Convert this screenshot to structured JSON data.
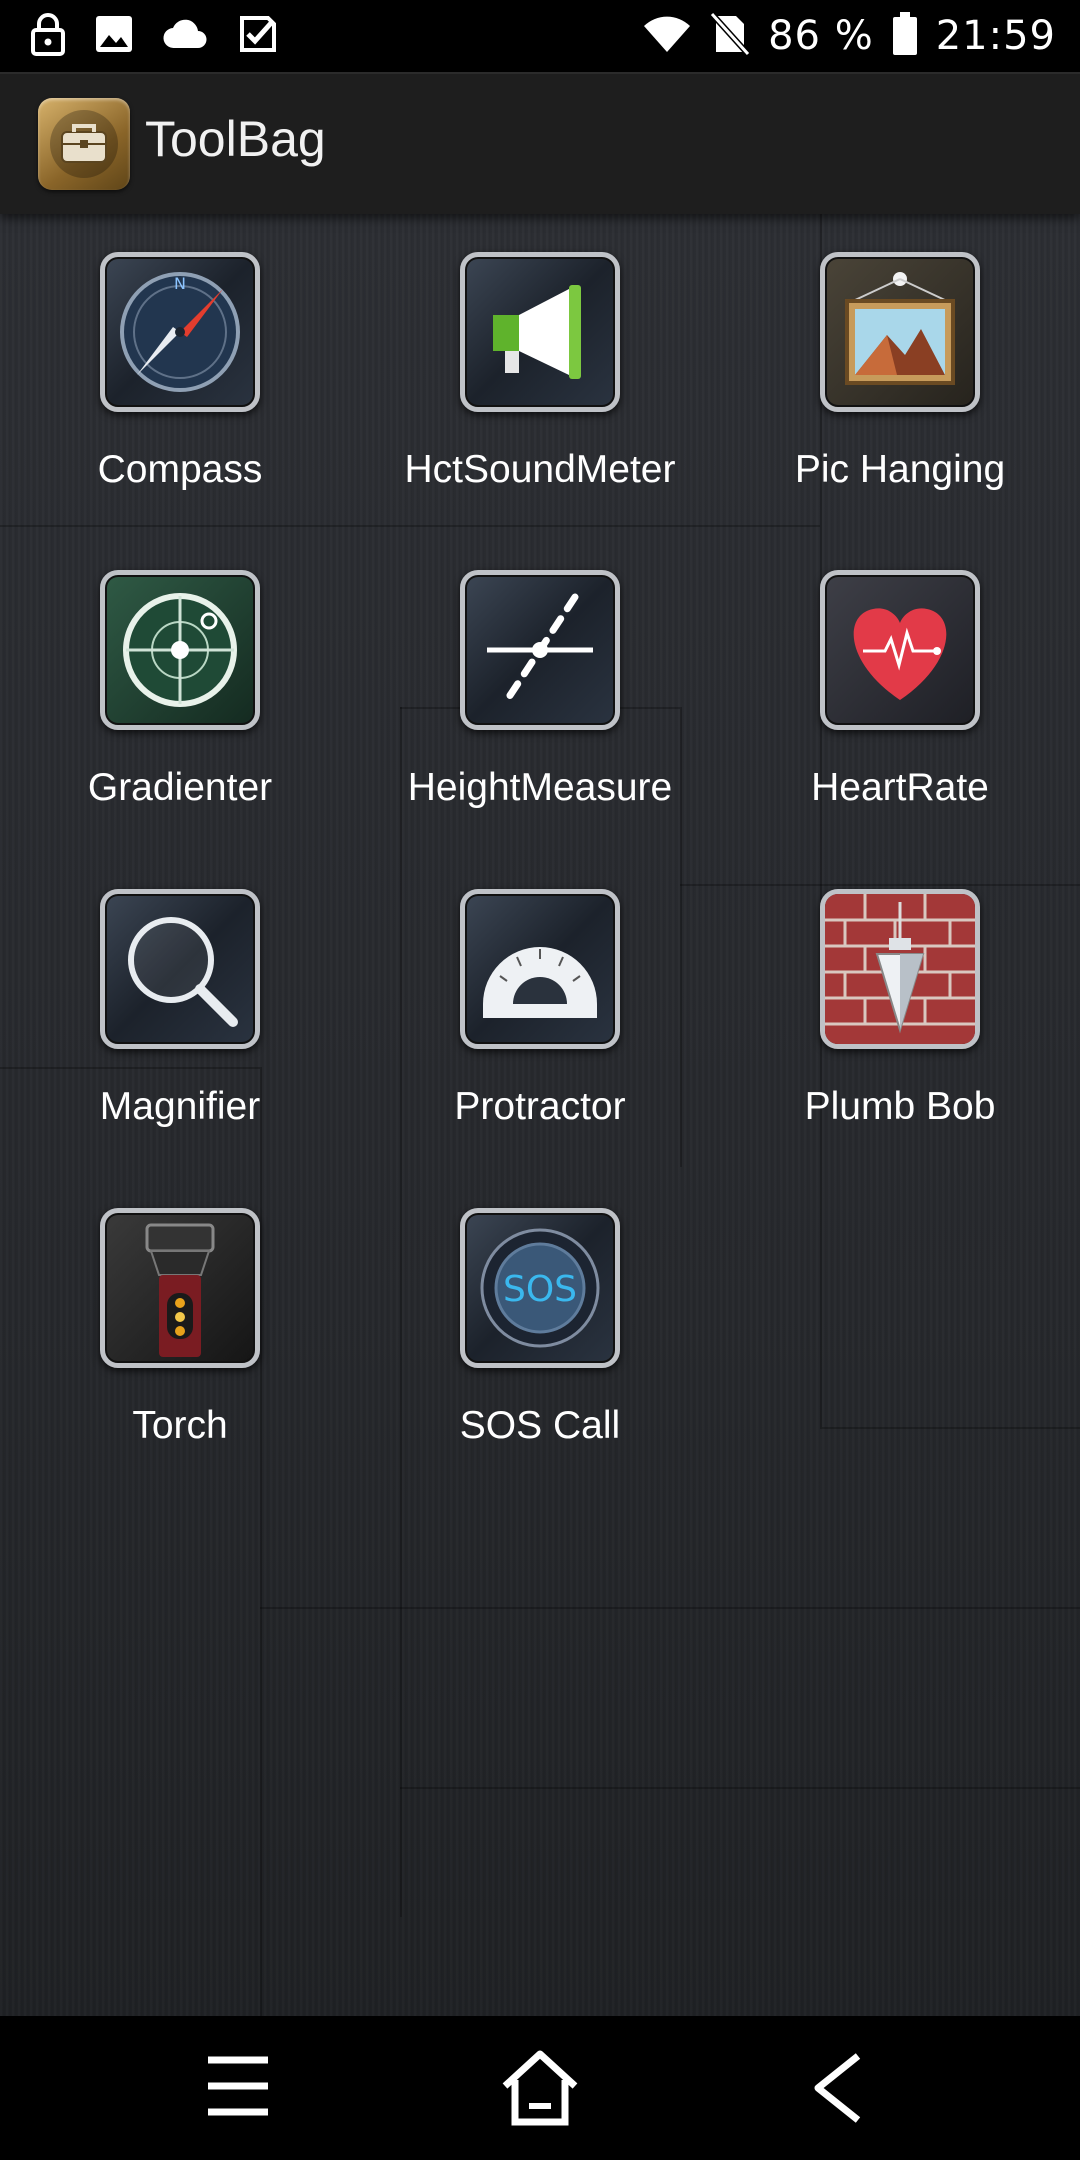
{
  "status_bar": {
    "battery": "86 %",
    "time": "21:59",
    "left_icons": [
      "lock-icon",
      "image-icon",
      "cloud-icon",
      "checklist-icon"
    ],
    "right_icons": [
      "wifi-icon",
      "no-sim-icon",
      "battery-icon"
    ]
  },
  "app_bar": {
    "title": "ToolBag",
    "logo_icon": "toolbox-icon"
  },
  "apps": [
    {
      "label": "Compass",
      "icon": "compass-icon"
    },
    {
      "label": "HctSoundMeter",
      "icon": "megaphone-icon"
    },
    {
      "label": "Pic Hanging",
      "icon": "picture-frame-icon"
    },
    {
      "label": "Gradienter",
      "icon": "level-icon"
    },
    {
      "label": "HeightMeasure",
      "icon": "height-measure-icon"
    },
    {
      "label": "HeartRate",
      "icon": "heart-icon"
    },
    {
      "label": "Magnifier",
      "icon": "magnifier-icon"
    },
    {
      "label": "Protractor",
      "icon": "protractor-icon"
    },
    {
      "label": "Plumb Bob",
      "icon": "plumb-bob-icon"
    },
    {
      "label": "Torch",
      "icon": "torch-icon"
    },
    {
      "label": "SOS Call",
      "icon": "sos-icon",
      "icon_text": "SOS"
    }
  ],
  "nav_bar": {
    "icons": [
      "menu-icon",
      "home-icon",
      "back-icon"
    ]
  },
  "colors": {
    "status_bar_bg": "#000000",
    "app_bar_bg": "#1e1e1e",
    "content_bg": "#2a2c30",
    "label_text": "#ffffff",
    "icon_border": "#bfc2c7"
  }
}
